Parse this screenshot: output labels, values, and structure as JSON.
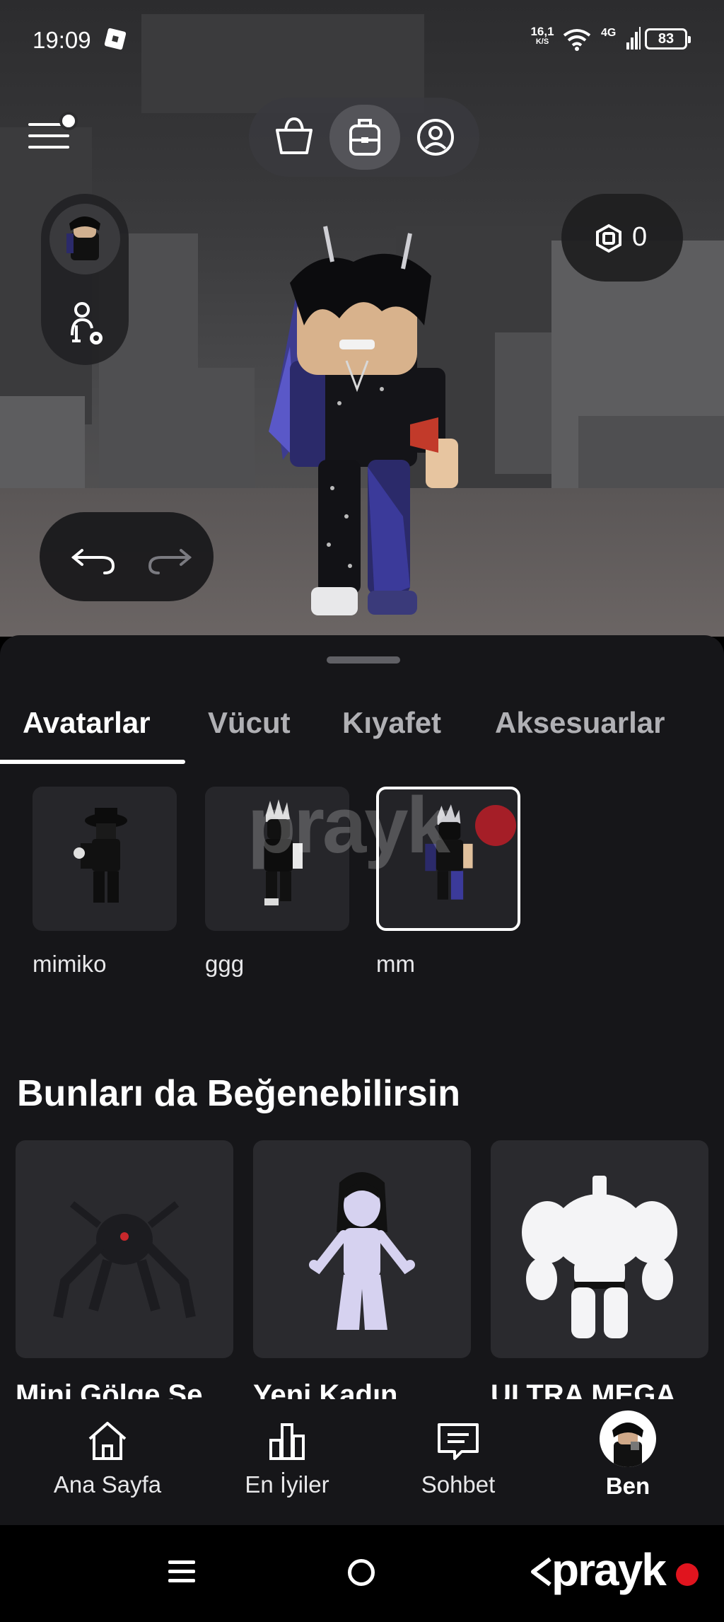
{
  "status_bar": {
    "time": "19:09",
    "speed_value": "16,1",
    "speed_unit": "K/S",
    "network": "4G",
    "battery": "83"
  },
  "top_nav": {
    "segments": [
      "shop-icon",
      "inventory-icon",
      "profile-icon"
    ],
    "active_segment": 1
  },
  "currency": {
    "icon": "robux-icon",
    "value": "0"
  },
  "tabs": [
    "Avatarlar",
    "Vücut",
    "Kıyafet",
    "Aksesuarlar"
  ],
  "active_tab": 0,
  "avatars": [
    {
      "name": "mimiko",
      "selected": false
    },
    {
      "name": "ggg",
      "selected": false
    },
    {
      "name": "mm",
      "selected": true
    }
  ],
  "recommendations": {
    "title": "Bunları da Beğenebilirsin",
    "items": [
      {
        "title": "Mini Gölge Se"
      },
      {
        "title": "Yeni Kadın"
      },
      {
        "title": "ULTRA MEGA"
      }
    ]
  },
  "bottom_nav": {
    "items": [
      {
        "label": "Ana Sayfa",
        "icon": "home-icon"
      },
      {
        "label": "En İyiler",
        "icon": "charts-icon"
      },
      {
        "label": "Sohbet",
        "icon": "chat-icon"
      },
      {
        "label": "Ben",
        "icon": "avatar-icon"
      }
    ],
    "active": 3
  },
  "watermark": {
    "text": "prayk"
  },
  "colors": {
    "sheet_bg": "#161619",
    "accent": "#ffffff",
    "watermark_red": "#e0141e"
  }
}
